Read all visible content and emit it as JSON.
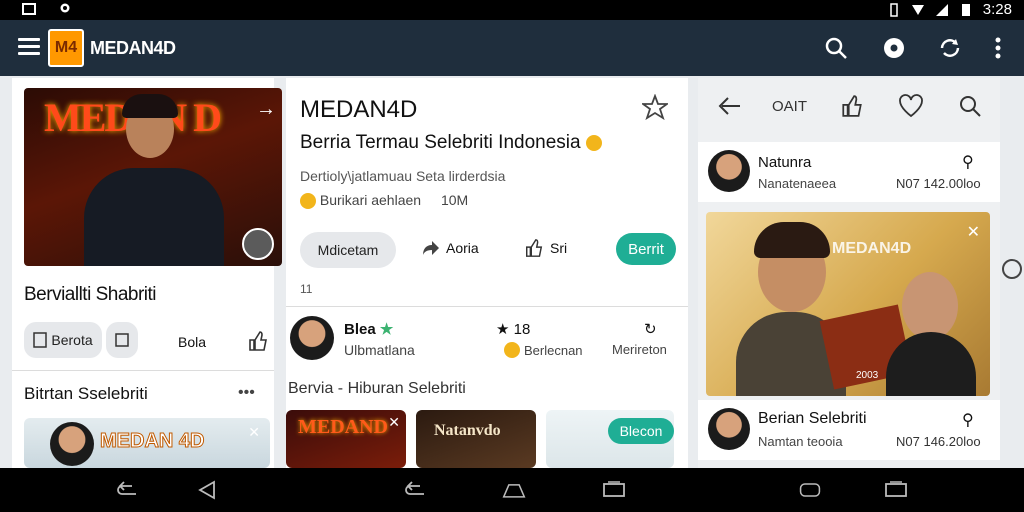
{
  "status_bar": {
    "time": "3:28"
  },
  "app_bar": {
    "title": "MEDAN4D",
    "logo_text": "M4"
  },
  "left_card": {
    "photo_overlay_text": "MEDAN D",
    "title": "Berviallti Shabriti",
    "btn1_label": "Berota",
    "btn3_label": "Bola",
    "section_title": "Bitrtan Sselebriti",
    "thumb_text": "MEDAN 4D"
  },
  "mid_card": {
    "title": "MEDAN4D",
    "subtitle": "Berria Termau Selebriti Indonesia",
    "meta_line": "Dertioly\\jatlamuau Seta lirderdsia",
    "meta_source": "Burikari aehlaen",
    "meta_count": "10M",
    "action_1": "Mdicetam",
    "action_2": "Aoria",
    "action_3": "Sri",
    "action_teal": "Berrit",
    "counter": "11",
    "comment": {
      "name": "Blea",
      "sub": "Ulbmatlana",
      "stat1": "18",
      "stat2_label": "Berlecnan",
      "stat3_label": "Merireton"
    },
    "section_title": "Bervia - Hiburan Selebriti",
    "thumb1_text": "MEDAND",
    "thumb2_text": "Natanvdo",
    "thumb3_badge": "Blecon"
  },
  "right_panel": {
    "header_label": "OAIT",
    "row1": {
      "name": "Natunra",
      "sub": "Nanatenaeea",
      "value": "N07 142.00loo"
    },
    "photo_text": "MEDAN4D",
    "photo_caption": "2003",
    "row2": {
      "name": "Berian Selebriti",
      "sub": "Namtan teooia",
      "value": "N07 146.20loo"
    }
  }
}
